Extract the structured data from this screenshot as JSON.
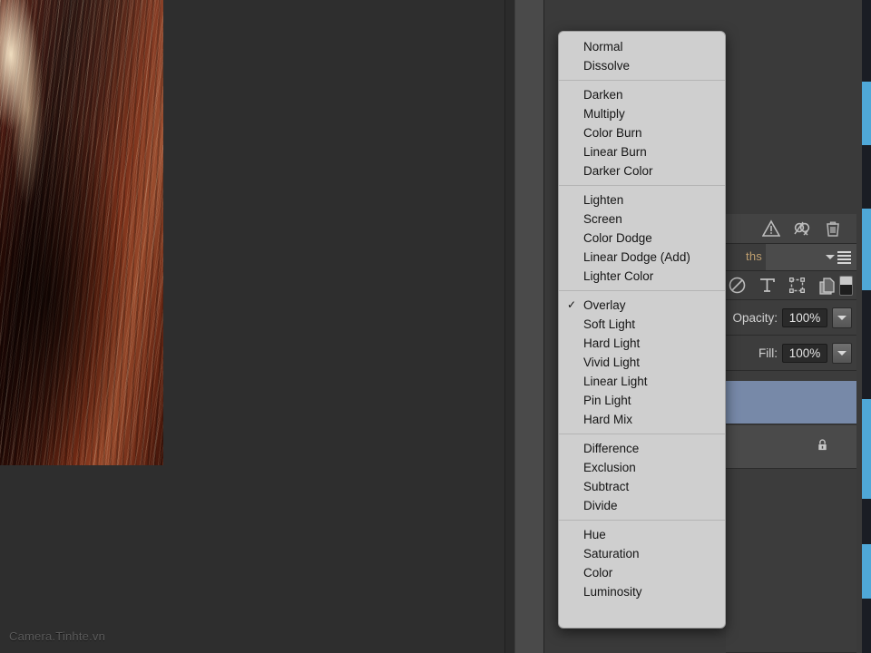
{
  "app": {
    "watermark": "Camera.Tinhte.vn"
  },
  "document": {
    "subject": "close-up photograph of reddish-brown hair"
  },
  "colors": {
    "menu_background": "#cfcfcf",
    "menu_text": "#151515",
    "panel_background": "#3c3c3c",
    "selected_layer": "#7789a8",
    "tab_active_text": "#c0a070",
    "accent_blue": "#4fa8d8"
  },
  "layers_panel": {
    "toolbar_icons": [
      "warning-icon",
      "unlink-icon",
      "trash-icon"
    ],
    "tabs": [
      {
        "label": "ths",
        "active": true
      }
    ],
    "panel_menu_icon": "panel-menu-icon",
    "filter_icons": [
      "adjustment-icon",
      "type-icon",
      "shape-icon",
      "smart-object-icon"
    ],
    "filter_toggle": "filter-toggle",
    "properties": [
      {
        "label": "Opacity:",
        "value": "100%"
      },
      {
        "label": "Fill:",
        "value": "100%"
      }
    ],
    "rows": [
      {
        "name": "selected-layer",
        "selected": true,
        "locked": false
      },
      {
        "name": "background-layer",
        "selected": false,
        "locked": true,
        "lock_icon": "lock-icon"
      }
    ]
  },
  "blend_menu": {
    "name": "blend-mode-dropdown",
    "selected": "Overlay",
    "groups": [
      {
        "items": [
          "Normal",
          "Dissolve"
        ]
      },
      {
        "items": [
          "Darken",
          "Multiply",
          "Color Burn",
          "Linear Burn",
          "Darker Color"
        ]
      },
      {
        "items": [
          "Lighten",
          "Screen",
          "Color Dodge",
          "Linear Dodge (Add)",
          "Lighter Color"
        ]
      },
      {
        "items": [
          "Overlay",
          "Soft Light",
          "Hard Light",
          "Vivid Light",
          "Linear Light",
          "Pin Light",
          "Hard Mix"
        ]
      },
      {
        "items": [
          "Difference",
          "Exclusion",
          "Subtract",
          "Divide"
        ]
      },
      {
        "items": [
          "Hue",
          "Saturation",
          "Color",
          "Luminosity"
        ]
      }
    ]
  }
}
